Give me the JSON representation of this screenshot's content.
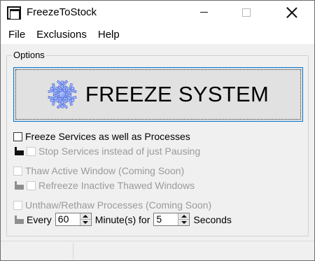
{
  "window": {
    "title": "FreezeToStock"
  },
  "titlebar": {
    "minimize": "minimize",
    "maximize": "maximize",
    "close": "close"
  },
  "menu": [
    "File",
    "Exclusions",
    "Help"
  ],
  "options": {
    "group_label": "Options",
    "freeze_button_label": "FREEZE SYSTEM",
    "freeze_services": {
      "label": "Freeze Services as well as Processes",
      "checked": false,
      "enabled": true
    },
    "stop_services": {
      "label": "Stop Services instead of just Pausing",
      "checked": false,
      "enabled": false
    },
    "thaw_active": {
      "label": "Thaw Active Window (Coming Soon)",
      "checked": false,
      "enabled": false
    },
    "refreeze_inactive": {
      "label": "Refreeze Inactive Thawed Windows",
      "checked": false,
      "enabled": false
    },
    "unthaw_rethaw": {
      "label": "Unthaw/Rethaw Processes (Coming Soon)",
      "checked": false,
      "enabled": false
    },
    "every_row": {
      "every_label": "Every",
      "minutes_value": "60",
      "minutes_label": "Minute(s) for",
      "seconds_value": "5",
      "seconds_label": "Seconds"
    }
  },
  "icons": {
    "app": "app-window-icon",
    "freeze": "snowflake-icon",
    "indent": "indent-arrow-icon"
  },
  "colors": {
    "focus_border": "#0078d7",
    "snowflake": "#8aa8ff",
    "disabled_text": "#9a9a9a"
  }
}
